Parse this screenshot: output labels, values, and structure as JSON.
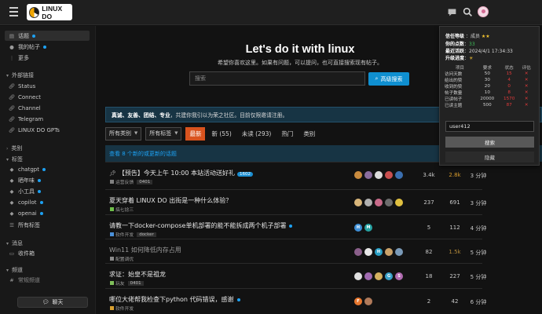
{
  "header": {
    "logo_text": "LINUX DO",
    "icons": [
      "menu-icon",
      "chat-icon",
      "search-icon",
      "user-avatar"
    ]
  },
  "sidebar": {
    "top_items": [
      {
        "label": "话题",
        "icon": "topics-icon",
        "dot": true,
        "active": true
      },
      {
        "label": "我的帖子",
        "icon": "user-icon",
        "dot": true,
        "active": false
      },
      {
        "label": "更多",
        "icon": "more-icon",
        "dot": false,
        "active": false
      }
    ],
    "external_header": "外部链接",
    "external_items": [
      {
        "label": "Status",
        "icon": "link-icon"
      },
      {
        "label": "Connect",
        "icon": "link-icon"
      },
      {
        "label": "Channel",
        "icon": "link-icon"
      },
      {
        "label": "Telegram",
        "icon": "link-icon"
      },
      {
        "label": "LINUX DO GPTs",
        "icon": "link-icon"
      }
    ],
    "categories_header": "类别",
    "tags_header": "标签",
    "tag_items": [
      {
        "label": "chatgpt",
        "dot": true
      },
      {
        "label": "晒年味",
        "dot": true
      },
      {
        "label": "小工具",
        "dot": true
      },
      {
        "label": "copilot",
        "dot": true
      },
      {
        "label": "openai",
        "dot": true
      },
      {
        "label": "所有标签",
        "dot": false
      }
    ],
    "messages_header": "消息",
    "messages_items": [
      {
        "label": "收件箱"
      }
    ],
    "channels_header": "频道",
    "channels_items": [
      {
        "label": "常规频道"
      }
    ],
    "chat_button": "聊天"
  },
  "hero": {
    "title": "Let's do it with linux",
    "subtitle": "希望你喜欢这里。如果有问题，可以提问，也可直接搜索现有帖子。",
    "search_placeholder": "搜索",
    "search_button": "高级搜索"
  },
  "banner": {
    "bold_part": "真诚、友善、团结、专业",
    "rest": "，共建你我引以为荣之社区。目前仅限邀请注册。"
  },
  "toolbar": {
    "category_dropdown": "所有类别",
    "tag_dropdown": "所有标签",
    "tabs": [
      {
        "label": "最新",
        "active": true
      },
      {
        "label": "新 (55)",
        "active": false
      },
      {
        "label": "未读 (293)",
        "active": false
      },
      {
        "label": "热门",
        "active": false
      },
      {
        "label": "类别",
        "active": false
      }
    ]
  },
  "new_topics_notice": "查看 8 个新的或更新的话题",
  "topics": [
    {
      "title": "【预告】今天上午 10:00 本站活动送好礼",
      "pinned": true,
      "badge": "1602",
      "new_dot": false,
      "read": false,
      "category": "运营反馈",
      "category_color": "#808080",
      "tags": [
        "0401"
      ],
      "avatars": [
        {
          "c": "#c98b3e",
          "t": ""
        },
        {
          "c": "#8a6d9e",
          "t": ""
        },
        {
          "c": "#dcdcdc",
          "t": ""
        },
        {
          "c": "#c94f4f",
          "t": ""
        },
        {
          "c": "#3b6fb0",
          "t": ""
        }
      ],
      "replies": "3.4k",
      "views": "2.8k",
      "activity": "3 分钟",
      "views_class": "hot"
    },
    {
      "title": "夏天穿着 LINUX DO 出街是一种什么体验？",
      "pinned": false,
      "badge": "",
      "new_dot": false,
      "read": false,
      "category": "搞七捻三",
      "category_color": "#6fbf4a",
      "tags": [],
      "avatars": [
        {
          "c": "#d9b67a",
          "t": ""
        },
        {
          "c": "#b0b0b0",
          "t": ""
        },
        {
          "c": "#c86b8a",
          "t": ""
        },
        {
          "c": "#6d6d6d",
          "t": ""
        },
        {
          "c": "#e0c040",
          "t": ""
        }
      ],
      "replies": "237",
      "views": "691",
      "activity": "3 分钟",
      "views_class": ""
    },
    {
      "title": "请教一下docker-compose单机部署的能不能拆成两个机子部署",
      "pinned": false,
      "badge": "",
      "new_dot": true,
      "read": false,
      "category": "软件开发",
      "category_color": "#4a90d9",
      "tags": [
        "docker"
      ],
      "avatars": [
        {
          "c": "#3e8fd6",
          "t": "H"
        },
        {
          "c": "#27a3a3",
          "t": "M"
        }
      ],
      "replies": "5",
      "views": "112",
      "activity": "4 分钟",
      "views_class": ""
    },
    {
      "title": "Win11 如何降低内存占用",
      "pinned": false,
      "badge": "",
      "new_dot": false,
      "read": true,
      "category": "配置调优",
      "category_color": "#8a8a8a",
      "tags": [],
      "avatars": [
        {
          "c": "#8a5f8a",
          "t": ""
        },
        {
          "c": "#e8e8e8",
          "t": ""
        },
        {
          "c": "#2aa0c6",
          "t": "H"
        },
        {
          "c": "#caa26a",
          "t": ""
        },
        {
          "c": "#7a9ab8",
          "t": ""
        }
      ],
      "replies": "82",
      "views": "1.5k",
      "activity": "5 分钟",
      "views_class": "warm"
    },
    {
      "title": "求证：始皇不是祖龙",
      "pinned": false,
      "badge": "",
      "new_dot": false,
      "read": false,
      "category": "玩友",
      "category_color": "#7fbf5a",
      "tags": [
        "0401"
      ],
      "avatars": [
        {
          "c": "#e0e0e0",
          "t": ""
        },
        {
          "c": "#a06ab0",
          "t": ""
        },
        {
          "c": "#d4b060",
          "t": ""
        },
        {
          "c": "#3aa1c9",
          "t": "G"
        },
        {
          "c": "#b06ab0",
          "t": "S"
        }
      ],
      "replies": "18",
      "views": "227",
      "activity": "5 分钟",
      "views_class": ""
    },
    {
      "title": "哪位大佬帮我检查下python 代码错误，感谢",
      "pinned": false,
      "badge": "",
      "new_dot": true,
      "read": false,
      "category": "软件开发",
      "category_color": "#d9a030",
      "tags": [],
      "avatars": [
        {
          "c": "#e8772e",
          "t": "F"
        },
        {
          "c": "#b07a5a",
          "t": ""
        }
      ],
      "replies": "2",
      "views": "42",
      "activity": "6 分钟",
      "views_class": ""
    }
  ],
  "user_panel": {
    "level_label": "信任等级",
    "level_value": "成员",
    "points_label": "你的点数",
    "points_value": "33",
    "last_active_label": "最近活跃",
    "last_active_value": "2024/4/1 17:34:33",
    "progress_label": "升级进度",
    "table_headers": [
      "项目",
      "要求",
      "状态",
      "评估"
    ],
    "table_rows": [
      {
        "item": "访问天数",
        "req": "50",
        "status": "15"
      },
      {
        "item": "给出的赞",
        "req": "30",
        "status": "4"
      },
      {
        "item": "收到的赞",
        "req": "20",
        "status": "0"
      },
      {
        "item": "帖子数量",
        "req": "10",
        "status": "8"
      },
      {
        "item": "已读帖子",
        "req": "20000",
        "status": "1570"
      },
      {
        "item": "已读主题",
        "req": "500",
        "status": "87"
      }
    ],
    "username_value": "user412",
    "search_button": "搜索",
    "close_button": "隐藏"
  }
}
